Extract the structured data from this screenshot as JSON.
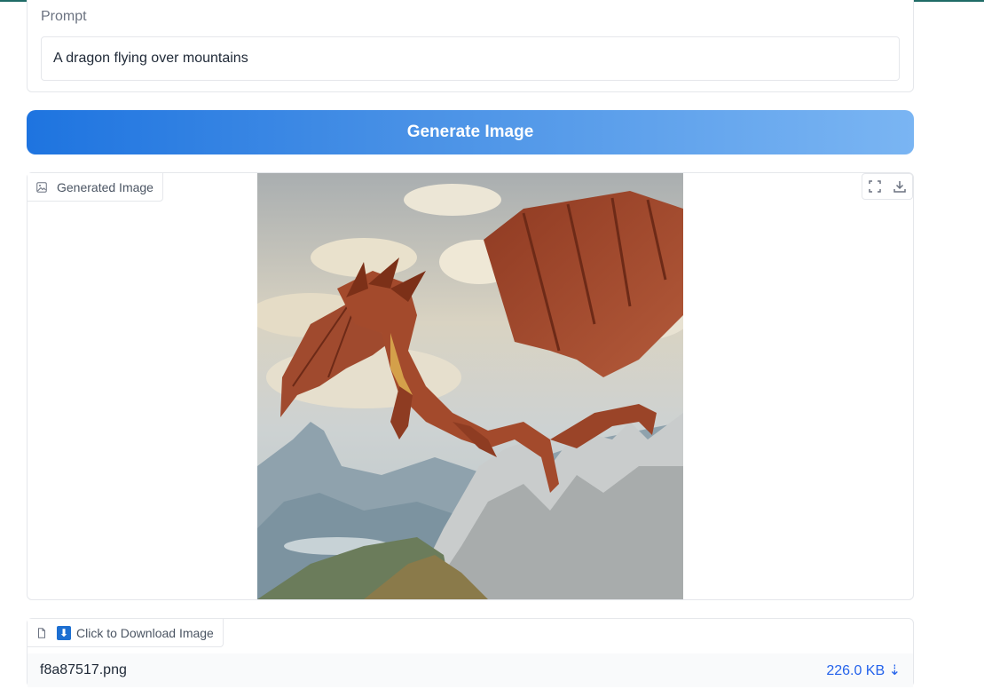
{
  "prompt": {
    "label": "Prompt",
    "value": "A dragon flying over mountains"
  },
  "generate_button": {
    "label": "Generate Image",
    "colors": {
      "start": "#1e74e0",
      "end": "#7ab5f3"
    }
  },
  "image_output": {
    "label": "Generated Image",
    "image_icon": "image-icon",
    "toolbar": [
      {
        "name": "fullscreen",
        "icon": "fullscreen-icon"
      },
      {
        "name": "download",
        "icon": "download-icon"
      }
    ]
  },
  "file_output": {
    "label": "Click to Download Image",
    "label_icon": "file-icon",
    "emoji": "⬇",
    "file_name": "f8a87517.png",
    "file_size": "226.0 KB ⇣"
  }
}
